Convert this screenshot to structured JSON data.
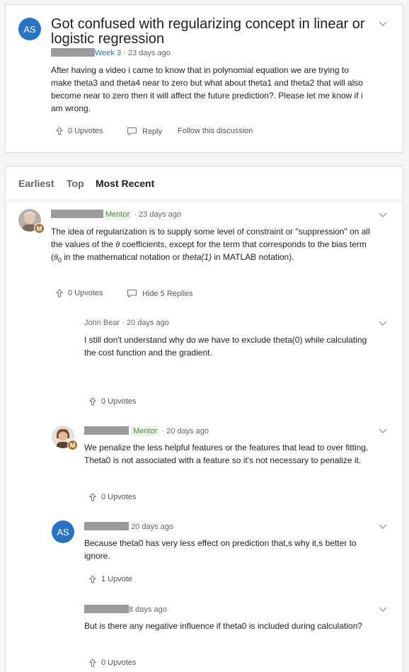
{
  "question": {
    "avatar_initials": "AS",
    "title": "Got confused with regularizing concept in linear or logistic regression",
    "week": "Week 3",
    "time": "· 23 days ago",
    "body": "After having a video i came to know that in polynomial equation we are trying to make theta3 and theta4 near to zero but what about theta1 and theta2 that will also become near to zero then it will affect the future prediction?. Please let me know if i am wrong.",
    "upvotes": "0 Upvotes",
    "reply": "Reply",
    "follow": "Follow this discussion"
  },
  "sort_tabs": [
    "Earliest",
    "Top",
    "Most Recent"
  ],
  "mentor_badge_letter": "M",
  "answer": {
    "role": "Mentor",
    "time": "· 23 days ago",
    "body_part1": "The idea of regularization is to supply some level of constraint or \"suppression\" on all the values of the ",
    "theta": "θ",
    "body_part2": " coefficients, except for the term that corresponds to the bias term (",
    "theta0": "θ",
    "sub0": "0",
    "body_part3": " in the mathematical notation or ",
    "theta1_italic": "theta(1)",
    "body_part4": " in MATLAB notation).",
    "upvotes": "0 Upvotes",
    "hide_replies": "Hide 5 Replies"
  },
  "replies": [
    {
      "author": "John Bear",
      "time": "· 20 days ago",
      "body": "I still don't understand why do we have to exclude theta(0) while calculating the cost function and the gradient.",
      "upvotes": "0 Upvotes"
    },
    {
      "role": "Mentor",
      "time": "· 20 days ago",
      "body": "We penalize the less helpful features or the features that lead to over fitting. Theta0 is not associated with a feature so it's not necessary to penalize it.",
      "upvotes": "0 Upvotes"
    },
    {
      "avatar_initials": "AS",
      "time": "20 days ago",
      "body": "Because theta0 has very less effect on prediction that,s why it,s better to ignore.",
      "upvotes": "1 Upvote"
    },
    {
      "time": "8 days ago",
      "body": "But is there any negative influence if theta0 is included during calculation?",
      "upvotes": "0 Upvotes"
    }
  ]
}
